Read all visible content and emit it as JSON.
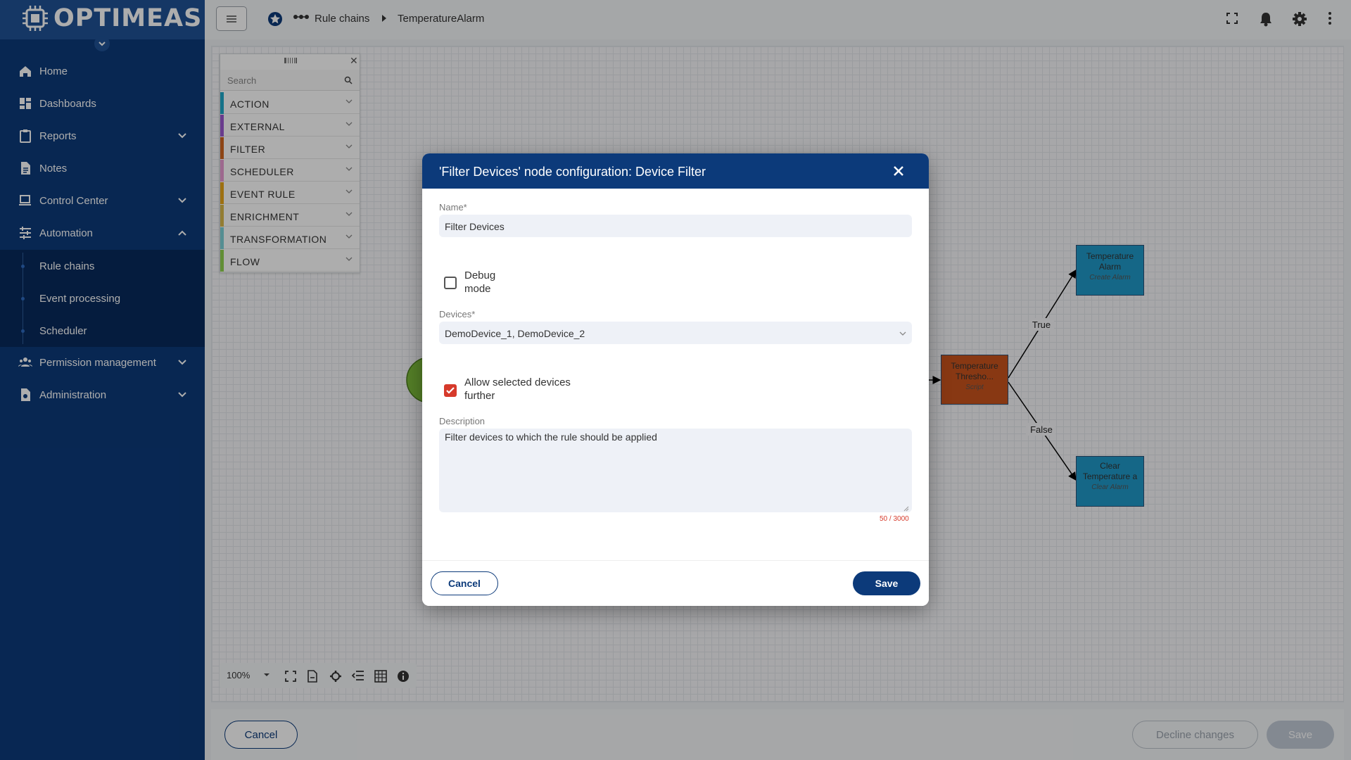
{
  "brand": {
    "name": "OPTIMEAS"
  },
  "sidebar": {
    "items": [
      {
        "label": "Home",
        "icon": "home-icon"
      },
      {
        "label": "Dashboards",
        "icon": "dashboard-icon"
      },
      {
        "label": "Reports",
        "icon": "clipboard-icon"
      },
      {
        "label": "Notes",
        "icon": "document-icon"
      },
      {
        "label": "Control Center",
        "icon": "devices-icon"
      },
      {
        "label": "Automation",
        "icon": "sliders-icon"
      },
      {
        "label": "Permission management",
        "icon": "people-icon"
      },
      {
        "label": "Administration",
        "icon": "admin-icon"
      }
    ],
    "automation_sub": [
      "Rule chains",
      "Event processing",
      "Scheduler"
    ]
  },
  "breadcrumb": {
    "section": "Rule chains",
    "current": "TemperatureAlarm"
  },
  "palette": {
    "search_placeholder": "Search",
    "categories": [
      {
        "label": "ACTION",
        "color": "#1fa8c9"
      },
      {
        "label": "EXTERNAL",
        "color": "#9b59d0"
      },
      {
        "label": "FILTER",
        "color": "#d0651f"
      },
      {
        "label": "SCHEDULER",
        "color": "#e89ad2"
      },
      {
        "label": "EVENT RULE",
        "color": "#e8a61a"
      },
      {
        "label": "ENRICHMENT",
        "color": "#d9b84a"
      },
      {
        "label": "TRANSFORMATION",
        "color": "#7ed1d8"
      },
      {
        "label": "FLOW",
        "color": "#8fd14f"
      }
    ]
  },
  "nodes": {
    "threshold": {
      "title": "Temperature Thresho...",
      "sub": "Script"
    },
    "alarm": {
      "title": "Temperature Alarm",
      "sub": "Create Alarm"
    },
    "clear": {
      "title": "Clear Temperature a",
      "sub": "Clear Alarm"
    },
    "edge_true": "True",
    "edge_false": "False"
  },
  "toolbar": {
    "zoom": "100%"
  },
  "footer": {
    "cancel": "Cancel",
    "decline": "Decline changes",
    "save": "Save"
  },
  "dialog": {
    "title": "'Filter Devices' node configuration: Device Filter",
    "name_label": "Name*",
    "name_value": "Filter Devices",
    "debug_label": "Debug mode",
    "debug_checked": false,
    "devices_label": "Devices*",
    "devices_value": "DemoDevice_1, DemoDevice_2",
    "allow_label": "Allow selected devices further",
    "allow_checked": true,
    "description_label": "Description",
    "description_value": "Filter devices to which the rule should be applied",
    "char_count": "50 / 3000",
    "cancel": "Cancel",
    "save": "Save"
  }
}
